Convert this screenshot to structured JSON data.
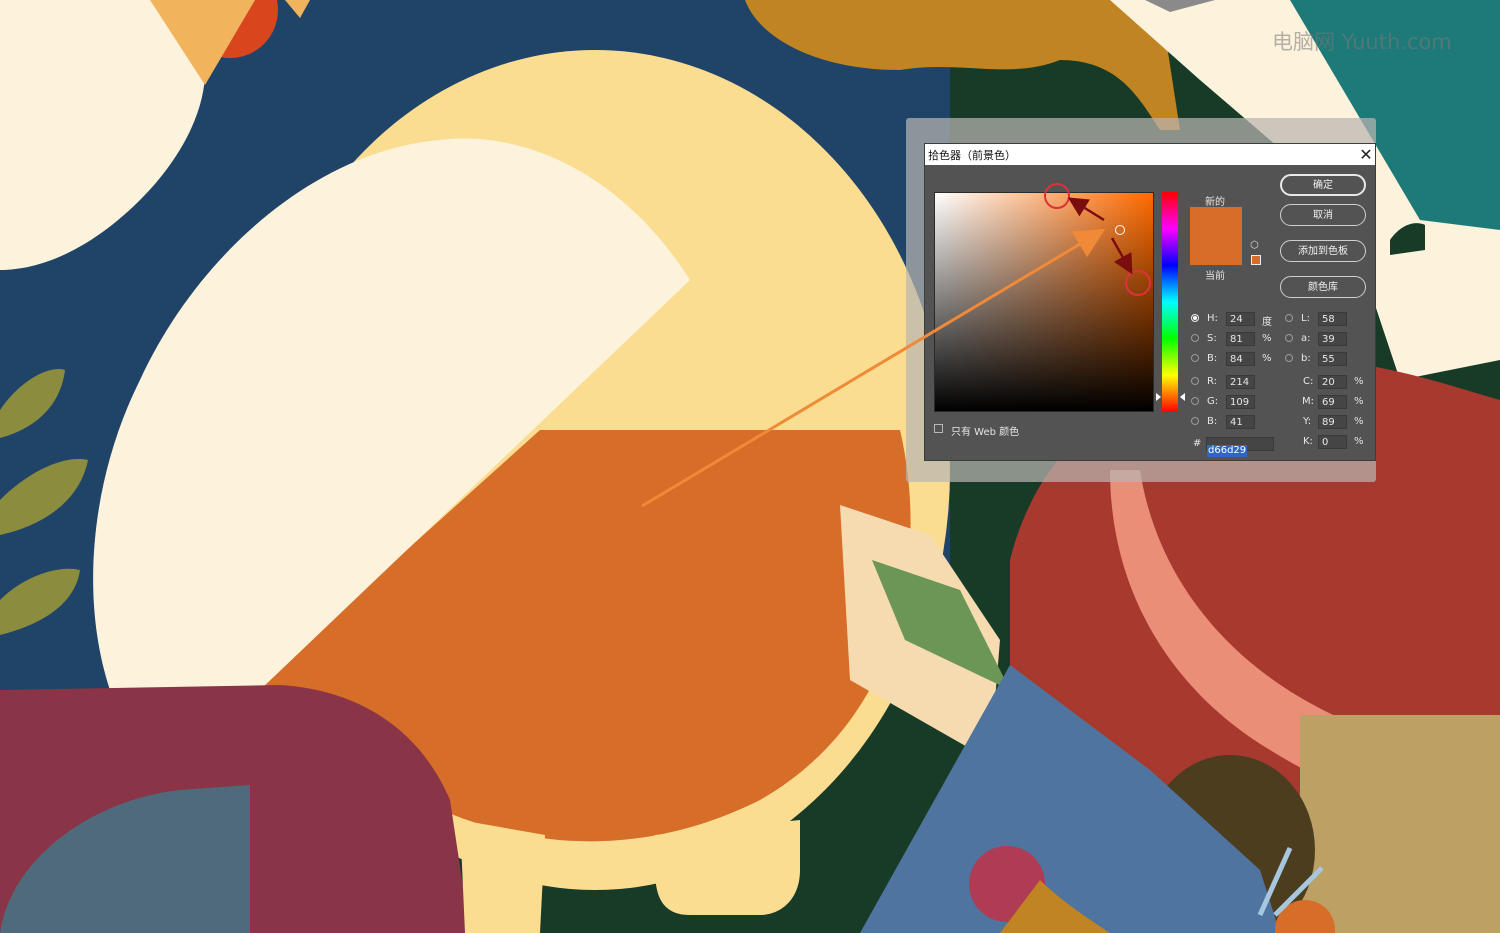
{
  "watermark": "电脑网 Yuuth.com",
  "dialog": {
    "title": "拾色器（前景色）",
    "close_glyph": "✕",
    "new_label": "新的",
    "current_label": "当前",
    "web_only_label": "只有 Web 颜色",
    "buttons": {
      "ok": "确定",
      "cancel": "取消",
      "add_swatch": "添加到色板",
      "color_library": "颜色库"
    },
    "fields": {
      "H": {
        "label": "H:",
        "value": "24",
        "unit": "度"
      },
      "S": {
        "label": "S:",
        "value": "81",
        "unit": "%"
      },
      "Bv": {
        "label": "B:",
        "value": "84",
        "unit": "%"
      },
      "R": {
        "label": "R:",
        "value": "214"
      },
      "G": {
        "label": "G:",
        "value": "109"
      },
      "Bl": {
        "label": "B:",
        "value": "41"
      },
      "L": {
        "label": "L:",
        "value": "58"
      },
      "a": {
        "label": "a:",
        "value": "39"
      },
      "b": {
        "label": "b:",
        "value": "55"
      },
      "C": {
        "label": "C:",
        "value": "20",
        "unit": "%"
      },
      "M": {
        "label": "M:",
        "value": "69",
        "unit": "%"
      },
      "Y": {
        "label": "Y:",
        "value": "89",
        "unit": "%"
      },
      "K": {
        "label": "K:",
        "value": "0",
        "unit": "%"
      },
      "hex_label": "#",
      "hex": "d66d29"
    },
    "selected_color": "#d66d29"
  },
  "colors": {
    "navy": "#1f4468",
    "cream": "#fdf3dc",
    "pale_yellow": "#fbdd92",
    "orange": "#d66d29",
    "forest": "#173b26",
    "mustard": "#c08422",
    "maroon": "#8a3448",
    "slate": "#4f6a7a",
    "blue": "#4f74a0",
    "red": "#a8392f",
    "salmon": "#ea8e77",
    "teal": "#1d7a78",
    "arrow": "#f08a38"
  }
}
